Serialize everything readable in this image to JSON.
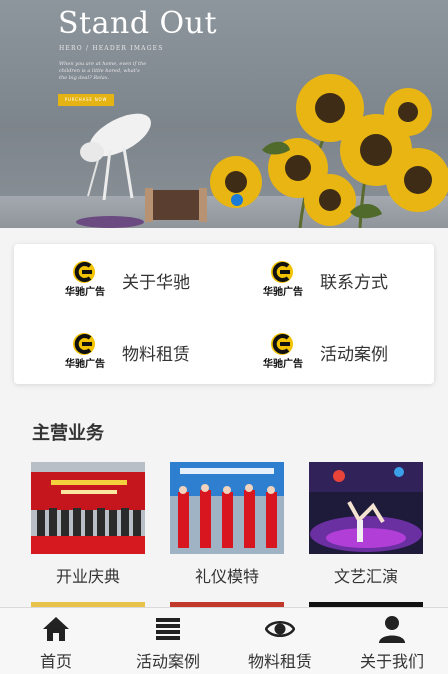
{
  "banner": {
    "title": "Stand Out",
    "subtitle": "HERO / HEADER IMAGES",
    "body": "When you are at home, even if the children is a little bored, what's the big deal? Relax.",
    "button_label": "PURCHASE NOW",
    "slide_indicator_color": "#1a7bd9"
  },
  "quick_nav": [
    {
      "label": "关于华驰",
      "logo_text": "华驰广告"
    },
    {
      "label": "联系方式",
      "logo_text": "华驰广告"
    },
    {
      "label": "物料租赁",
      "logo_text": "华驰广告"
    },
    {
      "label": "活动案例",
      "logo_text": "华驰广告"
    }
  ],
  "main_business": {
    "title": "主营业务",
    "items": [
      {
        "caption": "开业庆典"
      },
      {
        "caption": "礼仪模特"
      },
      {
        "caption": "文艺汇演"
      }
    ]
  },
  "tabbar": [
    {
      "label": "首页",
      "icon": "home-icon"
    },
    {
      "label": "活动案例",
      "icon": "list-icon"
    },
    {
      "label": "物料租赁",
      "icon": "eye-icon"
    },
    {
      "label": "关于我们",
      "icon": "user-icon"
    }
  ],
  "colors": {
    "brand_yellow": "#f2c200",
    "accent_blue": "#1a7bd9",
    "button_gold": "#e6b412"
  }
}
